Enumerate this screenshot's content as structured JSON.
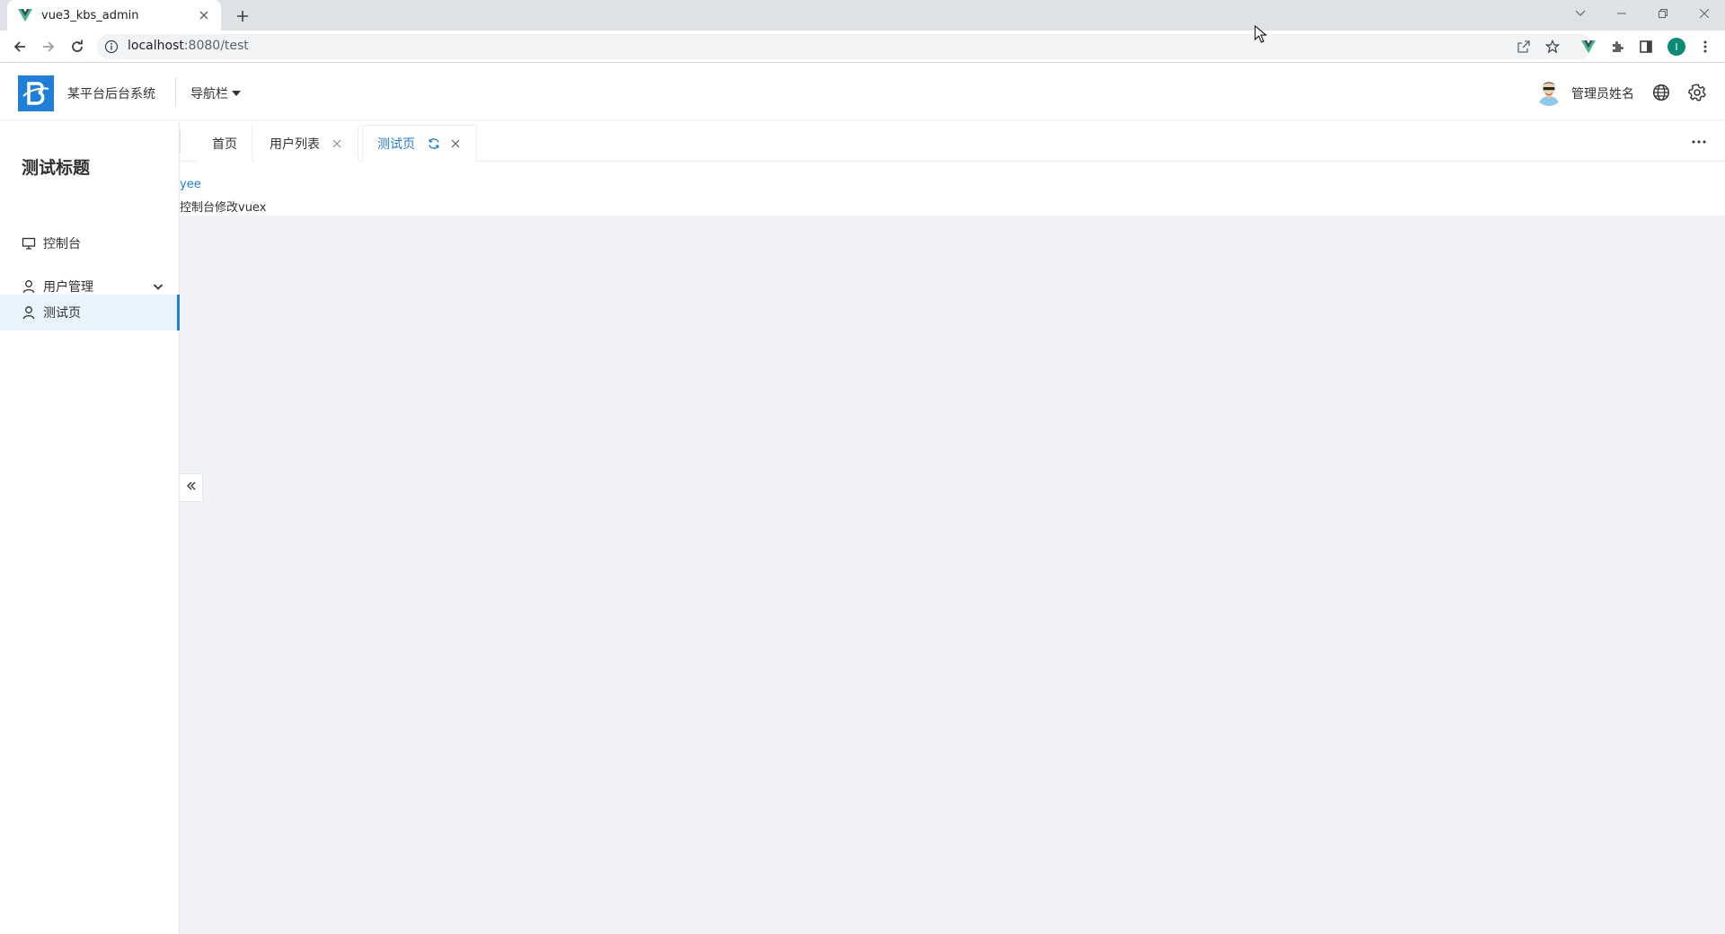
{
  "browser": {
    "tab_title": "vue3_kbs_admin",
    "url_host": "localhost",
    "url_path": ":8080/test",
    "profile_initial": "I"
  },
  "header": {
    "system_name": "某平台后台系统",
    "nav_label": "导航栏",
    "admin_name": "管理员姓名"
  },
  "sidebar": {
    "title": "测试标题",
    "items": [
      {
        "label": "控制台",
        "icon": "monitor-icon"
      },
      {
        "label": "用户管理",
        "icon": "user-icon",
        "has_submenu": true
      },
      {
        "label": "测试页",
        "icon": "user-icon",
        "active": true
      }
    ]
  },
  "tags": [
    {
      "label": "首页",
      "closable": false
    },
    {
      "label": "用户列表",
      "closable": true
    },
    {
      "label": "测试页",
      "closable": true,
      "active": true
    }
  ],
  "content": {
    "link_text": "yee",
    "text": "控制台修改vuex"
  },
  "colors": {
    "accent": "#1f7ed6",
    "main_bg": "#f0f2f5",
    "active_menu_bg": "#e8f4fd"
  }
}
